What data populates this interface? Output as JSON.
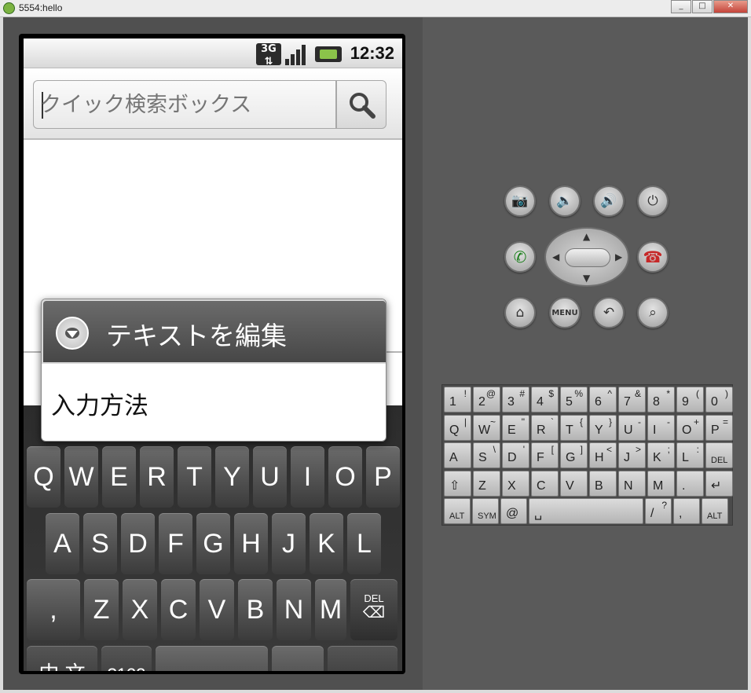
{
  "window": {
    "title": "5554:hello",
    "minimize": "_",
    "maximize": "□",
    "close": "✕"
  },
  "status": {
    "network": "3G",
    "time": "12:32"
  },
  "search": {
    "placeholder": "クイック検索ボックス"
  },
  "dialog": {
    "title": "テキストを編集",
    "items": [
      "入力方法"
    ]
  },
  "keyboard": {
    "row1": [
      "Q",
      "W",
      "E",
      "R",
      "T",
      "Y",
      "U",
      "I",
      "O",
      "P"
    ],
    "row2": [
      "A",
      "S",
      "D",
      "F",
      "G",
      "H",
      "J",
      "K",
      "L"
    ],
    "row3": [
      ",",
      "Z",
      "X",
      "C",
      "V",
      "B",
      "N",
      "M"
    ],
    "del": "DEL",
    "lang": "中 文",
    "num": "?123",
    "period": "。"
  },
  "controls": {
    "menu": "MENU"
  },
  "mini_keyboard": {
    "row1": [
      [
        "1",
        "!"
      ],
      [
        "2",
        "@"
      ],
      [
        "3",
        "#"
      ],
      [
        "4",
        "$"
      ],
      [
        "5",
        "%"
      ],
      [
        "6",
        "^"
      ],
      [
        "7",
        "&"
      ],
      [
        "8",
        "*"
      ],
      [
        "9",
        "("
      ],
      [
        "0",
        ")"
      ]
    ],
    "row2": [
      [
        "Q",
        "|"
      ],
      [
        "W",
        "~"
      ],
      [
        "E",
        "\""
      ],
      [
        "R",
        "`"
      ],
      [
        "T",
        "{"
      ],
      [
        "Y",
        "}"
      ],
      [
        "U",
        "-"
      ],
      [
        "I",
        "-"
      ],
      [
        "O",
        "+"
      ],
      [
        "P",
        "="
      ]
    ],
    "row3": [
      [
        "A",
        ""
      ],
      [
        "S",
        "\\"
      ],
      [
        "D",
        "'"
      ],
      [
        "F",
        "["
      ],
      [
        "G",
        "]"
      ],
      [
        "H",
        "<"
      ],
      [
        "J",
        ">"
      ],
      [
        "K",
        ";"
      ],
      [
        "L",
        ":"
      ],
      [
        "DEL",
        ""
      ]
    ],
    "row4": [
      [
        "⇧",
        ""
      ],
      [
        "Z",
        ""
      ],
      [
        "X",
        ""
      ],
      [
        "C",
        ""
      ],
      [
        "V",
        ""
      ],
      [
        "B",
        ""
      ],
      [
        "N",
        ""
      ],
      [
        "M",
        ""
      ],
      [
        ".",
        ""
      ],
      [
        "↵",
        ""
      ]
    ],
    "row5": [
      [
        "ALT",
        ""
      ],
      [
        "SYM",
        ""
      ],
      [
        "@",
        ""
      ],
      [
        "␣",
        ""
      ],
      [
        "/",
        "?"
      ],
      [
        ",",
        ""
      ],
      [
        "ALT",
        ""
      ]
    ]
  }
}
